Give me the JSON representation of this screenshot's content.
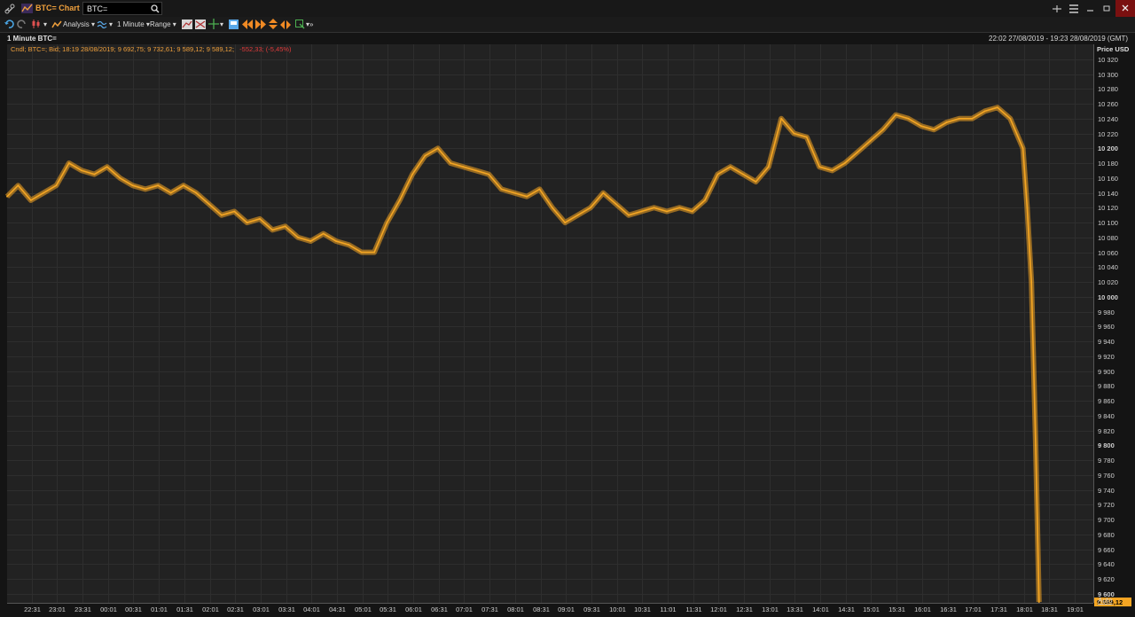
{
  "window": {
    "app_title": "BTC= Chart",
    "ric_value": "BTC="
  },
  "toolbar": {
    "analysis_label": "Analysis",
    "interval_label": "1 Minute",
    "range_label": "Range"
  },
  "chart_header": {
    "title": "1 Minute BTC=",
    "period": "22:02 27/08/2019 - 19:23 28/08/2019 (GMT)",
    "legend_main": "Cndl; BTC=; Bid;  18:19 28/08/2019; 9 692,75; 9 732,61; 9 589,12; 9 589,12;",
    "legend_change": "-552,33; (-5,45%)"
  },
  "colors": {
    "background": "#141414",
    "plot_background": "#222222",
    "series": "#f5a623",
    "accent": "#f0a03c",
    "negative": "#e03a3a",
    "grid": "#2e2e2e"
  },
  "icons": [
    "link-icon",
    "chart-icon",
    "search-icon",
    "undo-icon",
    "redo-icon",
    "candle-icon",
    "analysis-icon",
    "study-icon",
    "menu-icon",
    "minimize-icon",
    "restore-icon",
    "close-icon"
  ],
  "chart_data": {
    "type": "candlestick",
    "title": "1 Minute BTC=",
    "ylabel": "Price USD",
    "ylim": [
      9588,
      10340
    ],
    "yticks": [
      9600,
      9620,
      9640,
      9660,
      9680,
      9700,
      9720,
      9740,
      9760,
      9780,
      9800,
      9820,
      9840,
      9860,
      9880,
      9900,
      9920,
      9940,
      9960,
      9980,
      10000,
      10020,
      10040,
      10060,
      10080,
      10100,
      10120,
      10140,
      10160,
      10180,
      10200,
      10220,
      10240,
      10260,
      10280,
      10300,
      10320
    ],
    "ytick_labels": [
      "9 600",
      "9 620",
      "9 640",
      "9 660",
      "9 680",
      "9 700",
      "9 720",
      "9 740",
      "9 760",
      "9 780",
      "9 800",
      "9 820",
      "9 840",
      "9 860",
      "9 880",
      "9 900",
      "9 920",
      "9 940",
      "9 960",
      "9 980",
      "10 000",
      "10 020",
      "10 040",
      "10 060",
      "10 080",
      "10 100",
      "10 120",
      "10 140",
      "10 160",
      "10 180",
      "10 200",
      "10 220",
      "10 240",
      "10 260",
      "10 280",
      "10 300",
      "10 320"
    ],
    "xticks": [
      "22:31",
      "23:01",
      "23:31",
      "00:01",
      "00:31",
      "01:01",
      "01:31",
      "02:01",
      "02:31",
      "03:01",
      "03:31",
      "04:01",
      "04:31",
      "05:01",
      "05:31",
      "06:01",
      "06:31",
      "07:01",
      "07:31",
      "08:01",
      "08:31",
      "09:01",
      "09:31",
      "10:01",
      "10:31",
      "11:01",
      "11:31",
      "12:01",
      "12:31",
      "13:01",
      "13:31",
      "14:01",
      "14:31",
      "15:01",
      "15:31",
      "16:01",
      "16:31",
      "17:01",
      "17:31",
      "18:01",
      "18:31",
      "19:01"
    ],
    "x_start": "22:02 27/08/2019",
    "x_end": "19:23 28/08/2019",
    "last_price_label": "9 589,12",
    "last_price": 9589.12,
    "scale_mode": "Auto",
    "grid": true,
    "series": [
      {
        "name": "BTC=",
        "x": [
          "22:02",
          "22:15",
          "22:30",
          "22:45",
          "23:00",
          "23:15",
          "23:30",
          "23:45",
          "00:00",
          "00:15",
          "00:30",
          "00:45",
          "01:00",
          "01:15",
          "01:30",
          "01:45",
          "02:00",
          "02:15",
          "02:30",
          "02:45",
          "03:00",
          "03:15",
          "03:30",
          "03:45",
          "04:00",
          "04:15",
          "04:30",
          "04:45",
          "05:00",
          "05:15",
          "05:30",
          "05:45",
          "06:00",
          "06:15",
          "06:30",
          "06:45",
          "07:00",
          "07:15",
          "07:30",
          "07:45",
          "08:00",
          "08:15",
          "08:30",
          "08:45",
          "09:00",
          "09:15",
          "09:30",
          "09:45",
          "10:00",
          "10:15",
          "10:30",
          "10:45",
          "11:00",
          "11:15",
          "11:30",
          "11:45",
          "12:00",
          "12:15",
          "12:30",
          "12:45",
          "13:00",
          "13:15",
          "13:30",
          "13:45",
          "14:00",
          "14:15",
          "14:30",
          "14:45",
          "15:00",
          "15:15",
          "15:30",
          "15:45",
          "16:00",
          "16:15",
          "16:30",
          "16:45",
          "17:00",
          "17:15",
          "17:30",
          "17:45",
          "18:00",
          "18:05",
          "18:10",
          "18:15",
          "18:19"
        ],
        "values": [
          10135,
          10150,
          10130,
          10140,
          10150,
          10180,
          10170,
          10165,
          10175,
          10160,
          10150,
          10145,
          10150,
          10140,
          10150,
          10140,
          10125,
          10110,
          10115,
          10100,
          10105,
          10090,
          10095,
          10080,
          10075,
          10085,
          10075,
          10070,
          10060,
          10060,
          10100,
          10130,
          10165,
          10190,
          10200,
          10180,
          10175,
          10170,
          10165,
          10145,
          10140,
          10135,
          10145,
          10120,
          10100,
          10110,
          10120,
          10140,
          10125,
          10110,
          10115,
          10120,
          10115,
          10120,
          10115,
          10130,
          10165,
          10175,
          10165,
          10155,
          10175,
          10240,
          10220,
          10215,
          10175,
          10170,
          10180,
          10195,
          10210,
          10225,
          10245,
          10240,
          10230,
          10225,
          10235,
          10240,
          10240,
          10250,
          10255,
          10240,
          10200,
          10120,
          10020,
          9800,
          9589.12
        ]
      }
    ]
  }
}
